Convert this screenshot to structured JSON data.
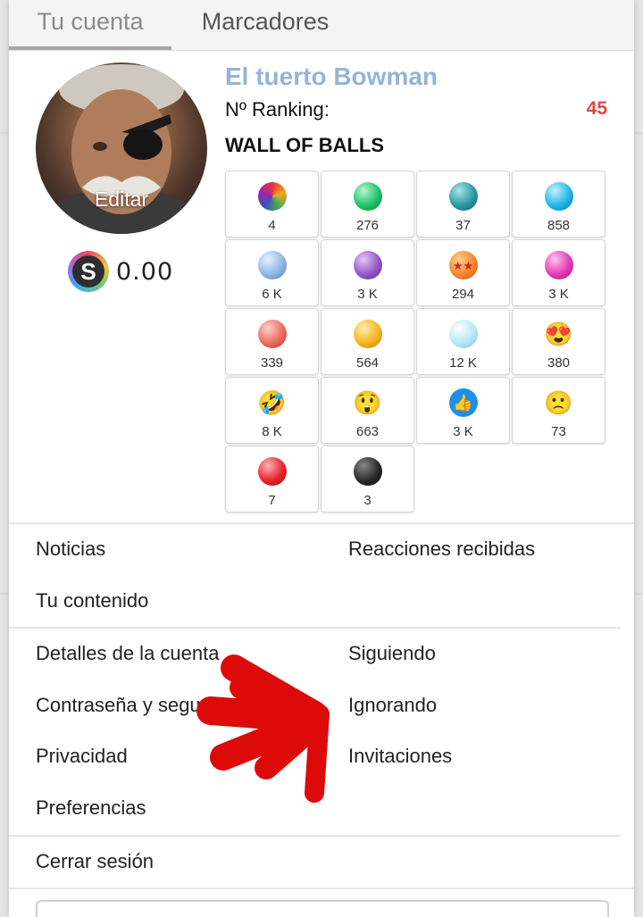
{
  "tabs": {
    "account": "Tu cuenta",
    "bookmarks": "Marcadores"
  },
  "profile": {
    "username": "El tuerto Bowman",
    "avatar_edit_label": "Editar",
    "ranking_label": "Nº Ranking:",
    "ranking_value": "45",
    "credits": "0.00",
    "credits_icon_letter": "S"
  },
  "wall": {
    "title": "WALL OF BALLS",
    "balls": [
      {
        "icon": "swirl-ball-icon",
        "count": "4"
      },
      {
        "icon": "green-gem-icon",
        "count": "276"
      },
      {
        "icon": "teal-gem-icon",
        "count": "37"
      },
      {
        "icon": "cyan-gem-icon",
        "count": "858"
      },
      {
        "icon": "light-blue-gem-icon",
        "count": "6 K"
      },
      {
        "icon": "purple-gem-icon",
        "count": "3 K"
      },
      {
        "icon": "dragon-ball-icon",
        "count": "294"
      },
      {
        "icon": "magenta-gem-icon",
        "count": "3 K"
      },
      {
        "icon": "salmon-gem-icon",
        "count": "339"
      },
      {
        "icon": "gold-gem-icon",
        "count": "564"
      },
      {
        "icon": "crystal-gem-icon",
        "count": "12 K"
      },
      {
        "icon": "heart-eyes-emoji-icon",
        "count": "380"
      },
      {
        "icon": "rofl-emoji-icon",
        "count": "8 K"
      },
      {
        "icon": "astonished-emoji-icon",
        "count": "663"
      },
      {
        "icon": "thumbs-up-icon",
        "count": "3 K"
      },
      {
        "icon": "frowning-emoji-icon",
        "count": "73"
      },
      {
        "icon": "red-gem-icon",
        "count": "7"
      },
      {
        "icon": "black-gem-icon",
        "count": "3"
      }
    ]
  },
  "menu": {
    "news": "Noticias",
    "reactions_received": "Reacciones recibidas",
    "your_content": "Tu contenido",
    "account_details": "Detalles de la cuenta",
    "following": "Siguiendo",
    "password_security": "Contraseña y seguridad",
    "ignoring": "Ignorando",
    "privacy": "Privacidad",
    "invitations": "Invitaciones",
    "preferences": "Preferencias",
    "logout": "Cerrar sesión"
  },
  "colors": {
    "username": "#94b4d6",
    "ranking_value": "#e4463c",
    "annotation_arrow": "#dd0a0a"
  }
}
